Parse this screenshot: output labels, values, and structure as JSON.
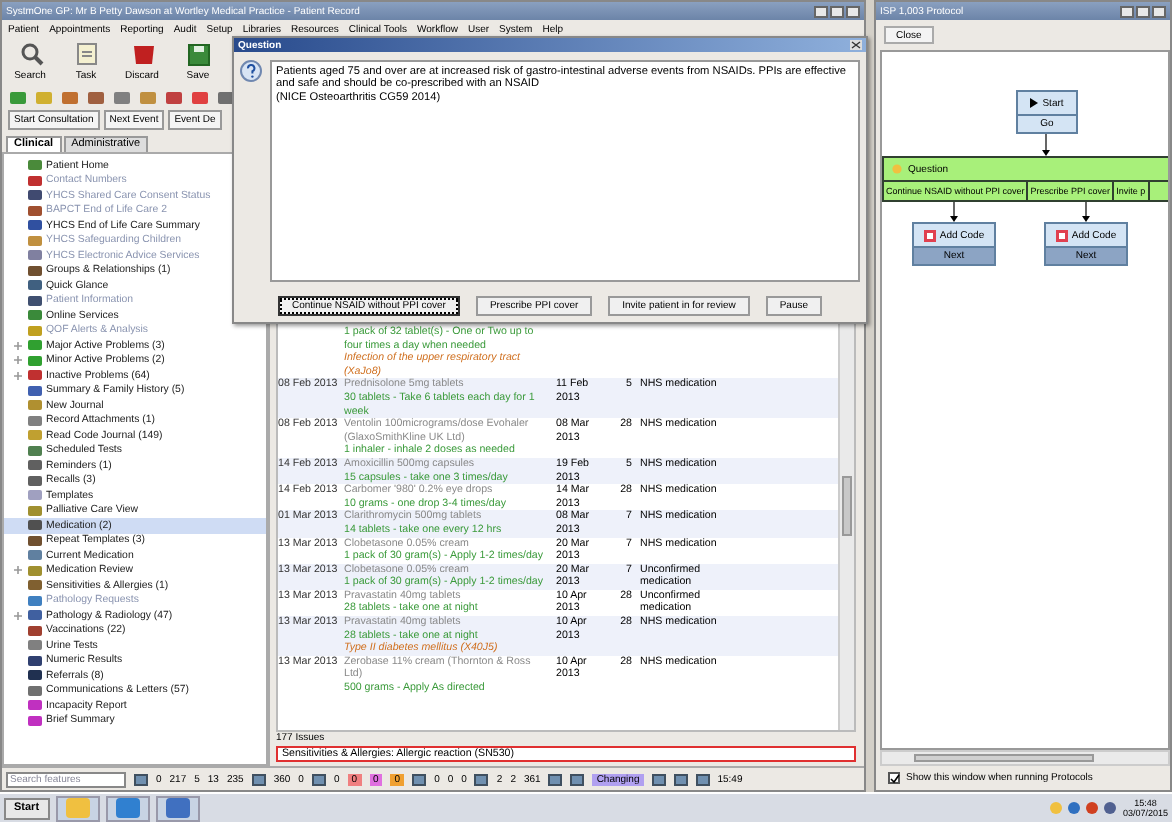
{
  "main_window": {
    "title": "SystmOne GP: Mr B Petty Dawson at Wortley Medical Practice - Patient Record",
    "menu": [
      "Patient",
      "Appointments",
      "Reporting",
      "Audit",
      "Setup",
      "Libraries",
      "Resources",
      "Clinical Tools",
      "Workflow",
      "User",
      "System",
      "Help"
    ],
    "toolbar": [
      {
        "label": "Search",
        "kind": "search"
      },
      {
        "label": "Task",
        "kind": "task"
      },
      {
        "label": "Discard",
        "kind": "discard"
      },
      {
        "label": "Save",
        "kind": "save"
      }
    ],
    "event_buttons": [
      "Start Consultation",
      "Next Event",
      "Event De"
    ],
    "tabs": [
      {
        "label": "Clinical",
        "selected": true
      },
      {
        "label": "Administrative",
        "selected": false
      }
    ],
    "sidebar_items": [
      {
        "label": "Patient Home",
        "disabled": false,
        "expandable": false,
        "selected": false,
        "color": "#4a8a3a"
      },
      {
        "label": "Contact Numbers",
        "disabled": true,
        "expandable": false,
        "selected": false,
        "color": "#c03030"
      },
      {
        "label": "YHCS Shared Care Consent Status",
        "disabled": true,
        "expandable": false,
        "selected": false,
        "color": "#404a70"
      },
      {
        "label": "BAPCT End of Life Care 2",
        "disabled": true,
        "expandable": false,
        "selected": false,
        "color": "#a05030"
      },
      {
        "label": "YHCS End of Life Care Summary",
        "disabled": false,
        "expandable": false,
        "selected": false,
        "color": "#3050a0"
      },
      {
        "label": "YHCS Safeguarding Children",
        "disabled": true,
        "expandable": false,
        "selected": false,
        "color": "#c09040"
      },
      {
        "label": "YHCS Electronic Advice Services",
        "disabled": true,
        "expandable": false,
        "selected": false,
        "color": "#8080a0"
      },
      {
        "label": "Groups & Relationships (1)",
        "disabled": false,
        "expandable": false,
        "selected": false,
        "color": "#705030"
      },
      {
        "label": "Quick Glance",
        "disabled": false,
        "expandable": false,
        "selected": false,
        "color": "#406080"
      },
      {
        "label": "Patient Information",
        "disabled": true,
        "expandable": false,
        "selected": false,
        "color": "#405070"
      },
      {
        "label": "Online Services",
        "disabled": false,
        "expandable": false,
        "selected": false,
        "color": "#3a8a3a"
      },
      {
        "label": "QOF Alerts & Analysis",
        "disabled": true,
        "expandable": false,
        "selected": false,
        "color": "#c0a020"
      },
      {
        "label": "Major Active Problems (3)",
        "disabled": false,
        "expandable": true,
        "selected": false,
        "color": "#30a030"
      },
      {
        "label": "Minor Active Problems (2)",
        "disabled": false,
        "expandable": true,
        "selected": false,
        "color": "#30a030"
      },
      {
        "label": "Inactive Problems (64)",
        "disabled": false,
        "expandable": true,
        "selected": false,
        "color": "#c03030"
      },
      {
        "label": "Summary & Family History (5)",
        "disabled": false,
        "expandable": false,
        "selected": false,
        "color": "#4060b0"
      },
      {
        "label": "New Journal",
        "disabled": false,
        "expandable": false,
        "selected": false,
        "color": "#b09030"
      },
      {
        "label": "Record Attachments (1)",
        "disabled": false,
        "expandable": false,
        "selected": false,
        "color": "#808080"
      },
      {
        "label": "Read Code Journal (149)",
        "disabled": false,
        "expandable": false,
        "selected": false,
        "color": "#c0a030"
      },
      {
        "label": "Scheduled Tests",
        "disabled": false,
        "expandable": false,
        "selected": false,
        "color": "#508050"
      },
      {
        "label": "Reminders (1)",
        "disabled": false,
        "expandable": false,
        "selected": false,
        "color": "#606060"
      },
      {
        "label": "Recalls (3)",
        "disabled": false,
        "expandable": false,
        "selected": false,
        "color": "#606060"
      },
      {
        "label": "Templates",
        "disabled": false,
        "expandable": false,
        "selected": false,
        "color": "#a0a0c0"
      },
      {
        "label": "Palliative Care View",
        "disabled": false,
        "expandable": false,
        "selected": false,
        "color": "#a09030"
      },
      {
        "label": "Medication (2)",
        "disabled": false,
        "expandable": false,
        "selected": true,
        "color": "#505050"
      },
      {
        "label": "Repeat Templates (3)",
        "disabled": false,
        "expandable": false,
        "selected": false,
        "color": "#705030"
      },
      {
        "label": "Current Medication",
        "disabled": false,
        "expandable": false,
        "selected": false,
        "color": "#6080a0"
      },
      {
        "label": "Medication Review",
        "disabled": false,
        "expandable": true,
        "selected": false,
        "color": "#a09030"
      },
      {
        "label": "Sensitivities & Allergies (1)",
        "disabled": false,
        "expandable": false,
        "selected": false,
        "color": "#806030"
      },
      {
        "label": "Pathology Requests",
        "disabled": true,
        "expandable": false,
        "selected": false,
        "color": "#4080c0"
      },
      {
        "label": "Pathology & Radiology (47)",
        "disabled": false,
        "expandable": true,
        "selected": false,
        "color": "#4060a0"
      },
      {
        "label": "Vaccinations (22)",
        "disabled": false,
        "expandable": false,
        "selected": false,
        "color": "#a04030"
      },
      {
        "label": "Urine Tests",
        "disabled": false,
        "expandable": false,
        "selected": false,
        "color": "#808080"
      },
      {
        "label": "Numeric Results",
        "disabled": false,
        "expandable": false,
        "selected": false,
        "color": "#304070"
      },
      {
        "label": "Referrals (8)",
        "disabled": false,
        "expandable": false,
        "selected": false,
        "color": "#203050"
      },
      {
        "label": "Communications & Letters (57)",
        "disabled": false,
        "expandable": false,
        "selected": false,
        "color": "#707070"
      },
      {
        "label": "Incapacity Report",
        "disabled": false,
        "expandable": false,
        "selected": false,
        "color": "#c030c0"
      },
      {
        "label": "Brief Summary",
        "disabled": false,
        "expandable": false,
        "selected": false,
        "color": "#c030c0"
      }
    ],
    "search_placeholder": "Search features",
    "medication_rows": [
      {
        "instructions": "1 pack of 32 tablet(s) - One or Two up to four times a day when needed",
        "indication": "Infection of the upper respiratory tract (XaJo8)"
      },
      {
        "date": "08 Feb 2013",
        "drug": "Prednisolone 5mg tablets",
        "instructions": "30 tablets - Take 6 tablets each day for 1 week",
        "end_date": "11 Feb 2013",
        "days": "5",
        "type": "NHS medication"
      },
      {
        "date": "08 Feb 2013",
        "drug": "Ventolin 100micrograms/dose Evohaler (GlaxoSmithKline UK Ltd)",
        "instructions": "1 inhaler - inhale 2 doses as needed",
        "end_date": "08 Mar 2013",
        "days": "28",
        "type": "NHS medication"
      },
      {
        "date": "14 Feb 2013",
        "drug": "Amoxicillin 500mg capsules",
        "instructions": "15 capsules - take one 3 times/day",
        "end_date": "19 Feb 2013",
        "days": "5",
        "type": "NHS medication"
      },
      {
        "date": "14 Feb 2013",
        "drug": "Carbomer '980' 0.2% eye drops",
        "instructions": "10 grams - one drop 3-4 times/day",
        "end_date": "14 Mar 2013",
        "days": "28",
        "type": "NHS medication"
      },
      {
        "date": "01 Mar 2013",
        "drug": "Clarithromycin 500mg tablets",
        "instructions": "14 tablets - take one every 12 hrs",
        "end_date": "08 Mar 2013",
        "days": "7",
        "type": "NHS medication"
      },
      {
        "date": "13 Mar 2013",
        "drug": "Clobetasone 0.05% cream",
        "instructions": "1 pack of 30 gram(s) - Apply 1-2 times/day",
        "end_date": "20 Mar 2013",
        "days": "7",
        "type": "NHS medication"
      },
      {
        "date": "13 Mar 2013",
        "drug": "Clobetasone 0.05% cream",
        "instructions": "1 pack of 30 gram(s) - Apply 1-2 times/day",
        "end_date": "20 Mar 2013",
        "days": "7",
        "type": "Unconfirmed medication"
      },
      {
        "date": "13 Mar 2013",
        "drug": "Pravastatin 40mg tablets",
        "instructions": "28 tablets - take one at night",
        "end_date": "10 Apr 2013",
        "days": "28",
        "type": "Unconfirmed medication"
      },
      {
        "date": "13 Mar 2013",
        "drug": "Pravastatin 40mg tablets",
        "instructions": "28 tablets - take one at night",
        "indication": "Type II diabetes mellitus (X40J5)",
        "end_date": "10 Apr 2013",
        "days": "28",
        "type": "NHS medication"
      },
      {
        "date": "13 Mar 2013",
        "drug": "Zerobase 11% cream (Thornton & Ross Ltd)",
        "instructions": "500 grams - Apply As directed",
        "end_date": "10 Apr 2013",
        "days": "28",
        "type": "NHS medication"
      }
    ],
    "issues_count": "177 Issues",
    "alert_line": "Sensitivities & Allergies: Allergic reaction (SN530)",
    "status_items": [
      {
        "kind": "icon"
      },
      {
        "kind": "count",
        "text": "0"
      },
      {
        "kind": "count",
        "text": "217"
      },
      {
        "kind": "count",
        "text": "5"
      },
      {
        "kind": "count",
        "text": "13"
      },
      {
        "kind": "count",
        "text": "235"
      },
      {
        "kind": "icon"
      },
      {
        "kind": "count",
        "text": "360"
      },
      {
        "kind": "count",
        "text": "0"
      },
      {
        "kind": "icon"
      },
      {
        "kind": "count",
        "text": "0"
      },
      {
        "kind": "badge",
        "text": "0",
        "color": "#f08080"
      },
      {
        "kind": "badge",
        "text": "0",
        "color": "#e070e0"
      },
      {
        "kind": "badge",
        "text": "0",
        "color": "#f0a030"
      },
      {
        "kind": "icon"
      },
      {
        "kind": "count",
        "text": "0"
      },
      {
        "kind": "count",
        "text": "0"
      },
      {
        "kind": "count",
        "text": "0"
      },
      {
        "kind": "icon"
      },
      {
        "kind": "count",
        "text": "2"
      },
      {
        "kind": "count",
        "text": "2"
      },
      {
        "kind": "count",
        "text": "361"
      },
      {
        "kind": "icon"
      },
      {
        "kind": "icon"
      },
      {
        "kind": "badge",
        "text": "Changing",
        "color": "#b0a0f0"
      },
      {
        "kind": "icon"
      },
      {
        "kind": "icon"
      },
      {
        "kind": "icon"
      },
      {
        "kind": "count",
        "text": "15:49"
      }
    ]
  },
  "dialog": {
    "title": "Question",
    "message": "Patients aged 75 and over are at increased risk of gastro-intestinal adverse events from NSAIDs. PPIs are effective and safe and should be co-prescribed with an NSAID\n(NICE Osteoarthritis CG59 2014)",
    "buttons": [
      {
        "label": "Continue NSAID without PPI cover",
        "selected": true
      },
      {
        "label": "Prescribe PPI cover",
        "selected": false
      },
      {
        "label": "Invite patient in for review",
        "selected": false
      },
      {
        "label": "Pause",
        "selected": false
      }
    ]
  },
  "protocol_window": {
    "title": "ISP 1,003 Protocol",
    "close_button": "Close",
    "start_node": {
      "title": "Start",
      "action": "Go"
    },
    "question_node": {
      "title": "Question",
      "options": [
        "Continue NSAID without PPI cover",
        "Prescribe PPI cover",
        "Invite p"
      ]
    },
    "code_nodes": [
      {
        "title": "Add Code",
        "action": "Next"
      },
      {
        "title": "Add Code",
        "action": "Next"
      }
    ],
    "show_window_checkbox": {
      "label": "Show this window when running Protocols",
      "checked": true
    }
  },
  "taskbar": {
    "start": "Start",
    "time": "15:48",
    "date": "03/07/2015"
  }
}
